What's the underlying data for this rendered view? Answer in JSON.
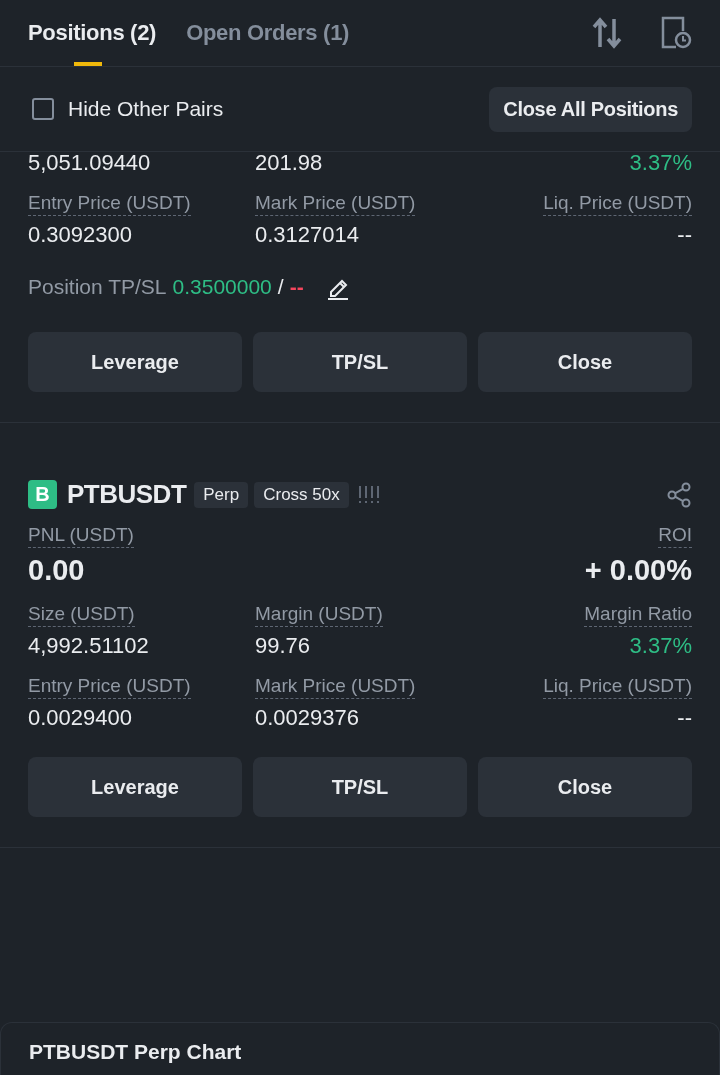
{
  "tabs": [
    {
      "label": "Positions (2)",
      "selected": true
    },
    {
      "label": "Open Orders (1)",
      "selected": false
    }
  ],
  "hide_other_pairs": {
    "label": "Hide Other Pairs",
    "checked": false
  },
  "close_all_button": "Close All Positions",
  "positions": [
    {
      "rows": [
        {
          "kind": "normal",
          "cells": [
            {
              "value": "5,051.09440",
              "positive": false
            },
            {
              "value": "201.98",
              "positive": false
            },
            {
              "value": "3.37%",
              "positive": true
            }
          ]
        },
        {
          "kind": "normal",
          "cells": [
            {
              "label": "Entry Price (USDT)",
              "value": "0.3092300",
              "positive": false
            },
            {
              "label": "Mark Price (USDT)",
              "value": "0.3127014",
              "positive": false
            },
            {
              "label": "Liq. Price (USDT)",
              "value": "--",
              "positive": false
            }
          ]
        }
      ],
      "tpsl": {
        "label": "Position TP/SL",
        "tp": "0.3500000",
        "separator": "/",
        "sl": "--"
      },
      "buttons": [
        "Leverage",
        "TP/SL",
        "Close"
      ]
    },
    {
      "header": {
        "badge": "B",
        "symbol": "PTBUSDT",
        "tags": [
          "Perp",
          "Cross 50x"
        ]
      },
      "rows": [
        {
          "kind": "big",
          "cells": [
            {
              "label": "PNL (USDT)",
              "value": "0.00",
              "positive": false
            },
            {},
            {
              "label": "ROI",
              "value": "+ 0.00%",
              "positive": false
            }
          ]
        },
        {
          "kind": "normal",
          "cells": [
            {
              "label": "Size (USDT)",
              "value": "4,992.51102",
              "positive": false
            },
            {
              "label": "Margin (USDT)",
              "value": "99.76",
              "positive": false
            },
            {
              "label": "Margin Ratio",
              "value": "3.37%",
              "positive": true
            }
          ]
        },
        {
          "kind": "normal",
          "cells": [
            {
              "label": "Entry Price (USDT)",
              "value": "0.0029400",
              "positive": false
            },
            {
              "label": "Mark Price (USDT)",
              "value": "0.0029376",
              "positive": false
            },
            {
              "label": "Liq. Price (USDT)",
              "value": "--",
              "positive": false
            }
          ]
        }
      ],
      "buttons": [
        "Leverage",
        "TP/SL",
        "Close"
      ]
    }
  ],
  "chart_bar": {
    "title": "PTBUSDT Perp Chart"
  }
}
